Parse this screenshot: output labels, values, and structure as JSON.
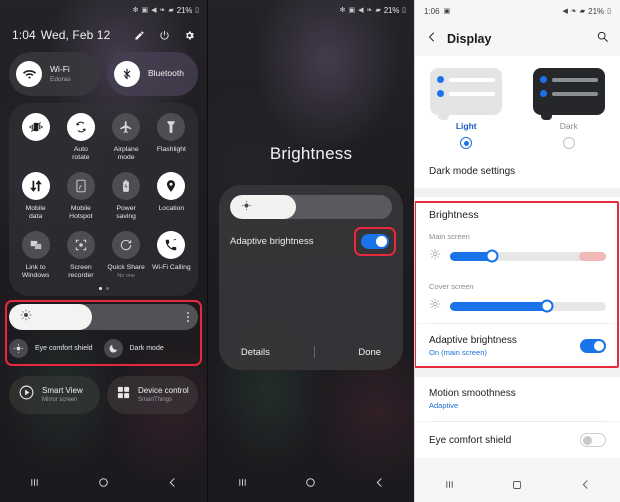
{
  "panel1": {
    "statusbar": {
      "icons": [
        "bluetooth-icon",
        "alarm-icon",
        "mute-icon",
        "nfc-icon",
        "signal-icon"
      ],
      "battery": "21%"
    },
    "header": {
      "time": "1:04",
      "date": "Wed, Feb 12",
      "actions": [
        "edit-pencil-icon",
        "power-icon",
        "settings-gear-icon"
      ]
    },
    "big_tiles": [
      {
        "title": "Wi-Fi",
        "subtitle": "Edoras",
        "icon": "wifi-icon",
        "state": "on"
      },
      {
        "title": "Bluetooth",
        "subtitle": "",
        "icon": "bluetooth-icon",
        "state": "on"
      }
    ],
    "tiles": [
      {
        "label": "Vibrate",
        "sub": "",
        "icon": "vibrate-icon",
        "state": "on"
      },
      {
        "label": "Auto\nrotate",
        "label1": "Auto",
        "label2": "rotate",
        "sub": "",
        "icon": "auto-rotate-icon",
        "state": "on"
      },
      {
        "label1": "Airplane",
        "label2": "mode",
        "sub": "",
        "icon": "airplane-icon",
        "state": "off"
      },
      {
        "label1": "Flashlight",
        "label2": "",
        "sub": "",
        "icon": "flashlight-icon",
        "state": "off"
      },
      {
        "label1": "Mobile",
        "label2": "data",
        "sub": "",
        "icon": "mobile-data-icon",
        "state": "on"
      },
      {
        "label1": "Mobile",
        "label2": "Hotspot",
        "sub": "",
        "icon": "hotspot-icon",
        "state": "off"
      },
      {
        "label1": "Power",
        "label2": "saving",
        "sub": "",
        "icon": "battery-saver-icon",
        "state": "off"
      },
      {
        "label1": "Location",
        "label2": "",
        "sub": "",
        "icon": "location-pin-icon",
        "state": "on"
      },
      {
        "label1": "Link to",
        "label2": "Windows",
        "sub": "",
        "icon": "link-to-windows-icon",
        "state": "off"
      },
      {
        "label1": "Screen",
        "label2": "recorder",
        "sub": "",
        "icon": "screen-recorder-icon",
        "state": "off"
      },
      {
        "label1": "Quick Share",
        "label2": "",
        "sub": "No one",
        "icon": "quick-share-icon",
        "state": "off"
      },
      {
        "label1": "Wi-Fi Calling",
        "label2": "",
        "sub": "",
        "icon": "wifi-calling-icon",
        "state": "on"
      }
    ],
    "brightness": {
      "slider_value_percent": 44,
      "menu_icon": "more-options-icon",
      "eye_comfort_label": "Eye comfort shield",
      "eye_comfort_icon": "eye-comfort-icon",
      "dark_mode_label": "Dark mode",
      "dark_mode_icon": "moon-icon"
    },
    "dual_tiles": [
      {
        "title": "Smart View",
        "subtitle": "Mirror screen",
        "icon": "smart-view-icon"
      },
      {
        "title": "Device control",
        "subtitle": "SmartThings",
        "icon": "device-control-icon"
      }
    ],
    "navbar": [
      "recents-icon",
      "home-icon",
      "back-icon"
    ]
  },
  "panel2": {
    "statusbar": {
      "icons": [
        "bluetooth-icon",
        "alarm-icon",
        "mute-icon",
        "nfc-icon",
        "signal-icon"
      ],
      "battery": "21%"
    },
    "title": "Brightness",
    "slider_value_percent": 41,
    "adaptive_label": "Adaptive brightness",
    "adaptive_state": "on",
    "buttons": {
      "details": "Details",
      "done": "Done"
    },
    "navbar": [
      "recents-icon",
      "home-icon",
      "back-icon"
    ]
  },
  "panel3": {
    "statusbar": {
      "time": "1:06",
      "left_icons": [
        "alarm-icon"
      ],
      "right_icons": [
        "mute-icon",
        "nfc-icon",
        "signal-icon"
      ],
      "battery": "21%"
    },
    "appbar": {
      "back_icon": "back-arrow-icon",
      "title": "Display",
      "search_icon": "search-icon"
    },
    "theme": {
      "light_label": "Light",
      "light_selected": true,
      "dark_label": "Dark",
      "dark_selected": false
    },
    "dark_mode_settings_label": "Dark mode settings",
    "brightness_section": {
      "title": "Brightness",
      "main_screen_label": "Main screen",
      "main_screen_value_percent": 27,
      "cover_screen_label": "Cover screen",
      "cover_screen_value_percent": 62,
      "brightness_icon": "brightness-low-icon"
    },
    "adaptive": {
      "title": "Adaptive brightness",
      "subtitle": "On (main screen)",
      "state": "on"
    },
    "motion": {
      "title": "Motion smoothness",
      "subtitle": "Adaptive"
    },
    "eye_comfort": {
      "title": "Eye comfort shield",
      "state": "off"
    },
    "navbar": [
      "recents-icon",
      "home-icon",
      "back-icon"
    ]
  },
  "colors": {
    "accent_blue": "#1a73e8",
    "highlight_red": "#e8283c",
    "warm_pink": "#f3b8b8"
  }
}
